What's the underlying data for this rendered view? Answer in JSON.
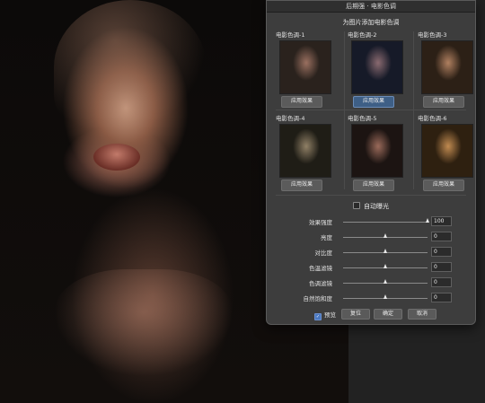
{
  "dialog": {
    "title": "后期强 · 电影色调",
    "heading": "为图片添加电影色调",
    "presets": [
      {
        "label": "电影色调-1",
        "button": "应用效果",
        "tint": "#2a221d"
      },
      {
        "label": "电影色调-2",
        "button": "应用效果",
        "tint": "#161a28"
      },
      {
        "label": "电影色调-3",
        "button": "应用效果",
        "tint": "#2c2016"
      },
      {
        "label": "电影色调-4",
        "button": "应用效果",
        "tint": "#1f1d16"
      },
      {
        "label": "电影色调-5",
        "button": "应用效果",
        "tint": "#1c1412"
      },
      {
        "label": "电影色调-6",
        "button": "应用效果",
        "tint": "#2e2010"
      }
    ],
    "auto_exposure_label": "自动曝光",
    "sliders": [
      {
        "name": "效果强度",
        "value": "100",
        "level": 1.0
      },
      {
        "name": "亮度",
        "value": "0",
        "level": 0.5
      },
      {
        "name": "对比度",
        "value": "0",
        "level": 0.5
      },
      {
        "name": "色温滤镜",
        "value": "0",
        "level": 0.5
      },
      {
        "name": "色调滤镜",
        "value": "0",
        "level": 0.5
      },
      {
        "name": "自然饱和度",
        "value": "0",
        "level": 0.5
      }
    ],
    "footer": {
      "preview_label": "预览",
      "reset_label": "复位",
      "ok_label": "确定",
      "cancel_label": "取消"
    }
  },
  "colors": {
    "active_button": "#3e5f86",
    "dialog_bg": "#3d3d3d"
  }
}
